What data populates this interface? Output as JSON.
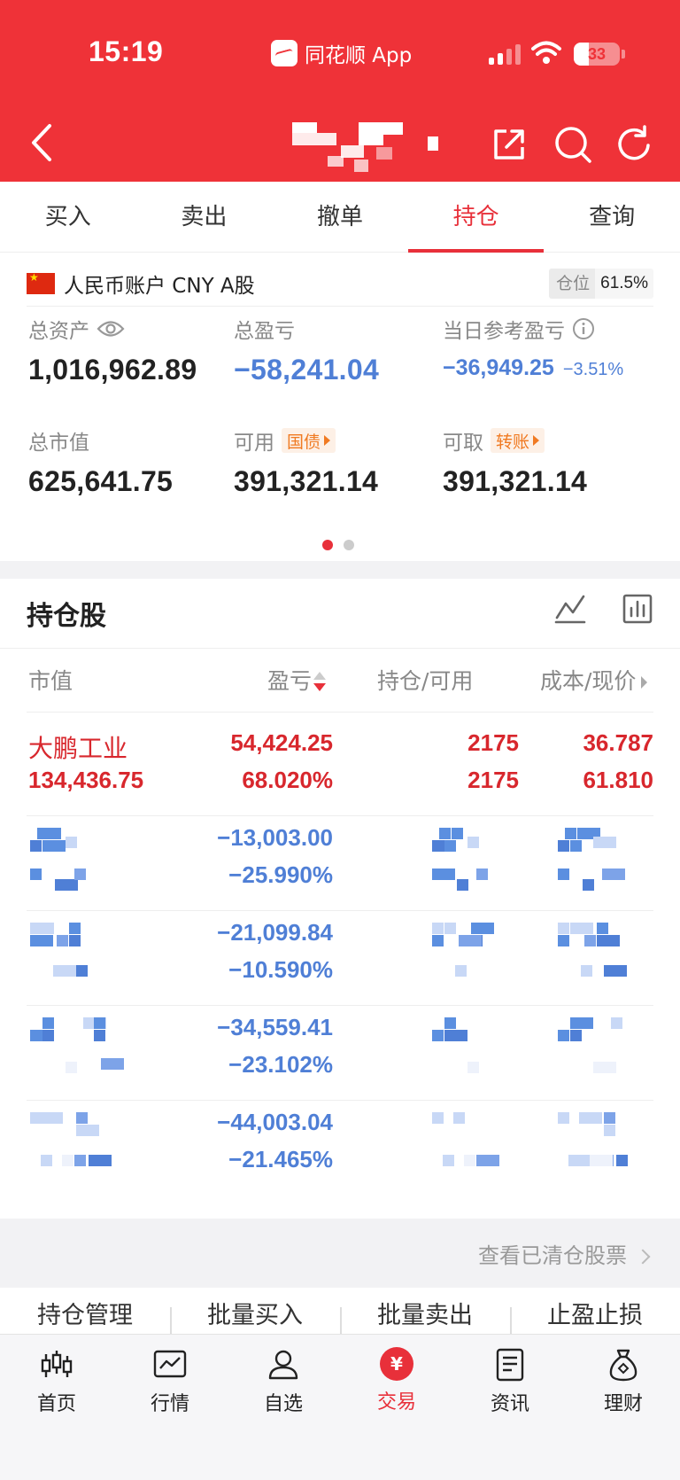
{
  "status_bar": {
    "time": "15:19",
    "app_name": "同花顺 App",
    "battery": "33",
    "battery_level_pct": 33
  },
  "header": {
    "title_obscured": true,
    "icons": [
      "back-icon",
      "share-icon",
      "search-icon",
      "refresh-icon"
    ]
  },
  "tabs": [
    {
      "label": "买入",
      "active": false
    },
    {
      "label": "卖出",
      "active": false
    },
    {
      "label": "撤单",
      "active": false
    },
    {
      "label": "持仓",
      "active": true
    },
    {
      "label": "查询",
      "active": false
    }
  ],
  "account": {
    "label": "人民币账户 CNY A股",
    "position_key": "仓位",
    "position_value": "61.5%",
    "total_assets_label": "总资产",
    "total_assets": "1,016,962.89",
    "total_pl_label": "总盈亏",
    "total_pl": "−58,241.04",
    "daily_pl_label": "当日参考盈亏",
    "daily_pl": "−36,949.25",
    "daily_pl_pct": "−3.51%",
    "market_value_label": "总市值",
    "market_value": "625,641.75",
    "available_label": "可用",
    "available_tag": "国债",
    "available": "391,321.14",
    "withdrawable_label": "可取",
    "withdrawable_tag": "转账",
    "withdrawable": "391,321.14",
    "page_dots": {
      "count": 2,
      "active": 0
    }
  },
  "holdings": {
    "title": "持仓股",
    "columns": [
      "市值",
      "盈亏",
      "持仓/可用",
      "成本/现价"
    ],
    "rows": [
      {
        "name": "大鹏工业",
        "market_value": "134,436.75",
        "pl": "54,424.25",
        "pl_pct": "68.020%",
        "position": "2175",
        "available": "2175",
        "cost": "36.787",
        "price": "61.810",
        "color": "#d8272d",
        "obscured": false
      },
      {
        "name": "",
        "market_value": "",
        "pl": "−13,003.00",
        "pl_pct": "−25.990%",
        "position": "",
        "available": "",
        "cost": "",
        "price": "",
        "color": "#4f7fd6",
        "obscured": true
      },
      {
        "name": "",
        "market_value": "",
        "pl": "−21,099.84",
        "pl_pct": "−10.590%",
        "position": "",
        "available": "",
        "cost": "",
        "price": "",
        "color": "#4f7fd6",
        "obscured": true
      },
      {
        "name": "",
        "market_value": "",
        "pl": "−34,559.41",
        "pl_pct": "−23.102%",
        "position": "",
        "available": "",
        "cost": "",
        "price": "",
        "color": "#4f7fd6",
        "obscured": true
      },
      {
        "name": "",
        "market_value": "",
        "pl": "−44,003.04",
        "pl_pct": "−21.465%",
        "position": "",
        "available": "",
        "cost": "",
        "price": "",
        "color": "#4f7fd6",
        "obscured": true
      }
    ],
    "cleared_link": "查看已清仓股票"
  },
  "actions": [
    "持仓管理",
    "批量买入",
    "批量卖出",
    "止盈止损"
  ],
  "bottom_nav": [
    {
      "label": "首页",
      "icon": "candlestick-icon",
      "active": false
    },
    {
      "label": "行情",
      "icon": "chart-line-icon",
      "active": false
    },
    {
      "label": "自选",
      "icon": "person-icon",
      "active": false
    },
    {
      "label": "交易",
      "icon": "yuan-icon",
      "active": true
    },
    {
      "label": "资讯",
      "icon": "document-icon",
      "active": false
    },
    {
      "label": "理财",
      "icon": "money-bag-icon",
      "active": false
    }
  ],
  "colors": {
    "brand_red": "#ef3238",
    "loss_blue": "#4f7fd6",
    "gain_red": "#d8272d",
    "tag_orange": "#f07a22"
  }
}
